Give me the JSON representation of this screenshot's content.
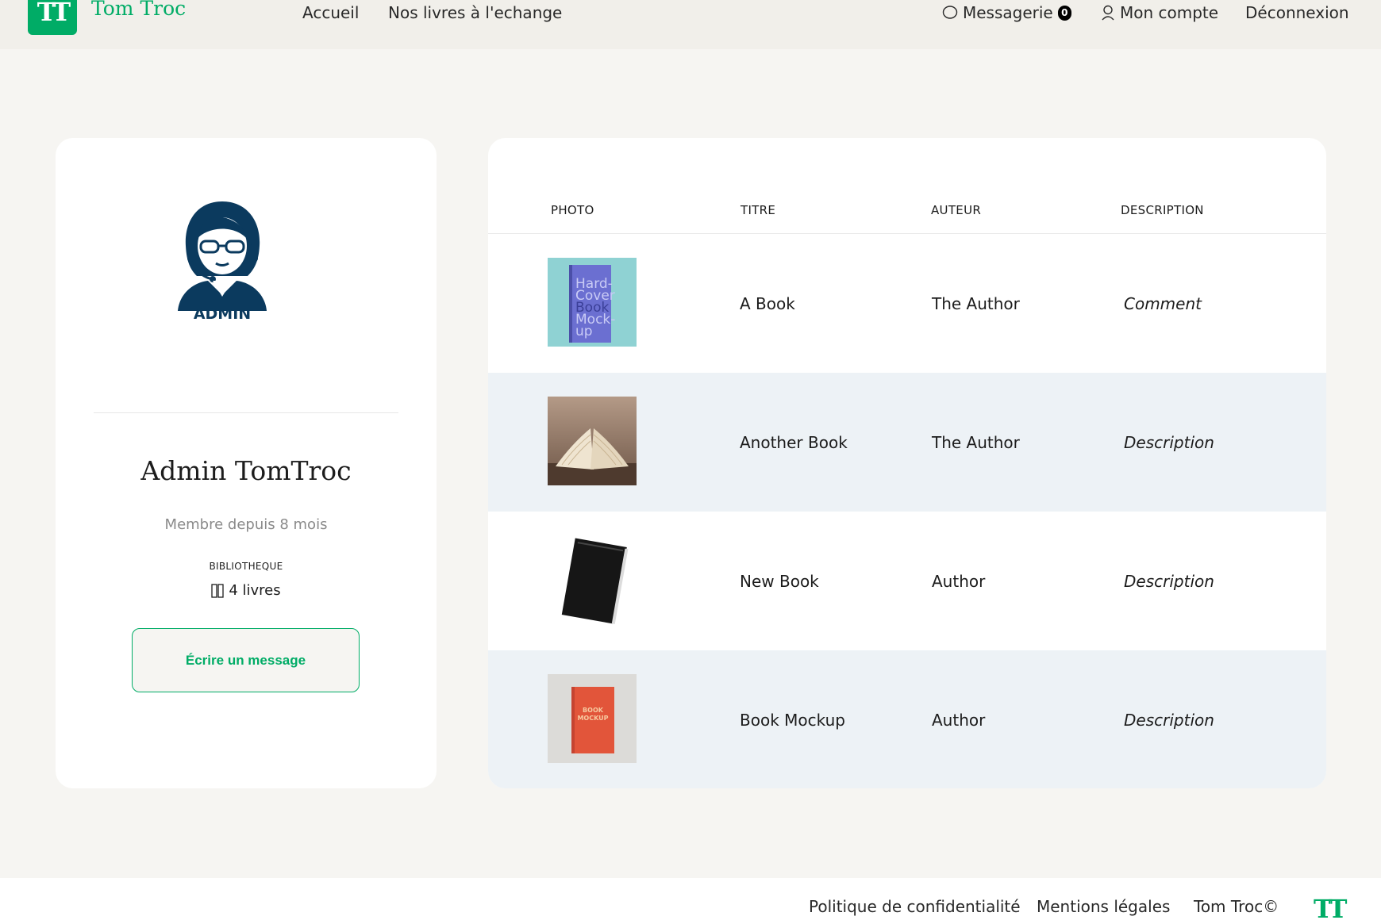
{
  "header": {
    "logo_mark": "TT",
    "brand": "Tom Troc",
    "nav": {
      "home": "Accueil",
      "books": "Nos livres à l'echange"
    },
    "messages_label": "Messagerie",
    "messages_count": "0",
    "account_label": "Mon compte",
    "logout_label": "Déconnexion"
  },
  "profile": {
    "avatar_caption": "ADMIN",
    "name": "Admin TomTroc",
    "member_since": "Membre depuis 8 mois",
    "library_label": "BIBLIOTHEQUE",
    "book_count": "4 livres",
    "message_button": "Écrire un message"
  },
  "table": {
    "columns": [
      "PHOTO",
      "TITRE",
      "AUTEUR",
      "DESCRIPTION"
    ],
    "rows": [
      {
        "title": "A Book",
        "author": "The Author",
        "description": "Comment",
        "cover_text": "Hard-Cover Book Mock-up"
      },
      {
        "title": "Another Book",
        "author": "The Author",
        "description": "Description"
      },
      {
        "title": "New Book",
        "author": "Author",
        "description": "Description"
      },
      {
        "title": "Book Mockup",
        "author": "Author",
        "description": "Description",
        "cover_text": "BOOK MOCKUP"
      }
    ]
  },
  "footer": {
    "privacy": "Politique de confidentialité",
    "legal": "Mentions légales",
    "copyright": "Tom Troc©",
    "logo_mark": "TT"
  },
  "colors": {
    "brand_green": "#00ac66",
    "page_bg": "#f6f5f2",
    "header_bg": "#f1efea",
    "row_alt_bg": "#edf2f6",
    "avatar_navy": "#0b3a5e"
  }
}
